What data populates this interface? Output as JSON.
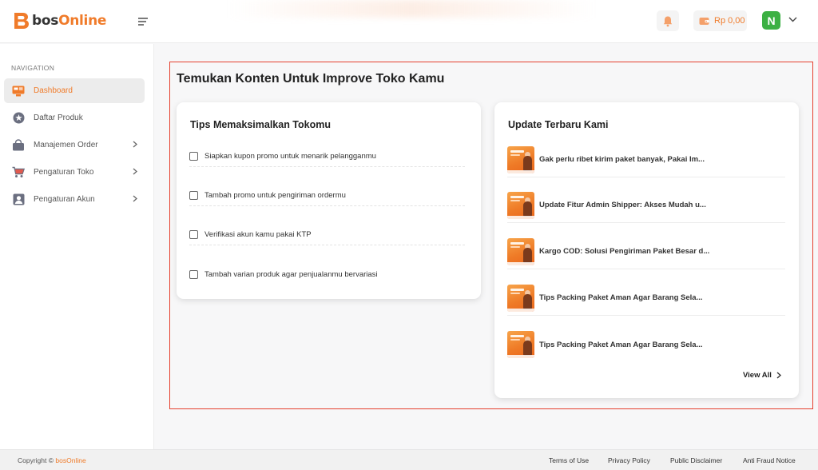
{
  "header": {
    "brand": "bosOnline",
    "brand_prefix": "bos",
    "brand_suffix": "Online",
    "wallet_amount": "Rp 0,00",
    "avatar_initial": "N"
  },
  "sidebar": {
    "nav_title": "NAVIGATION",
    "items": [
      {
        "label": "Dashboard",
        "icon": "dashboard-icon",
        "active": true,
        "has_submenu": false
      },
      {
        "label": "Daftar Produk",
        "icon": "star-icon",
        "active": false,
        "has_submenu": false
      },
      {
        "label": "Manajemen Order",
        "icon": "bag-icon",
        "active": false,
        "has_submenu": true
      },
      {
        "label": "Pengaturan Toko",
        "icon": "cart-icon",
        "active": false,
        "has_submenu": true
      },
      {
        "label": "Pengaturan Akun",
        "icon": "user-icon",
        "active": false,
        "has_submenu": true
      }
    ]
  },
  "main": {
    "title": "Temukan Konten Untuk Improve Toko Kamu",
    "tips": {
      "title": "Tips Memaksimalkan Tokomu",
      "items": [
        "Siapkan kupon promo untuk menarik pelangganmu",
        "Tambah promo untuk pengiriman ordermu",
        "Verifikasi akun kamu pakai KTP",
        "Tambah varian produk agar penjualanmu bervariasi"
      ]
    },
    "updates": {
      "title": "Update Terbaru Kami",
      "items": [
        "Gak perlu ribet kirim paket banyak, Pakai Im...",
        "Update Fitur Admin Shipper: Akses Mudah u...",
        "Kargo COD: Solusi Pengiriman Paket Besar d...",
        "Tips Packing Paket Aman Agar Barang Sela...",
        "Tips Packing Paket Aman Agar Barang Sela..."
      ],
      "view_all": "View All"
    }
  },
  "footer": {
    "copyright_prefix": "Copyright ©",
    "copyright_brand": "bosOnline",
    "links": [
      "Terms of Use",
      "Privacy Policy",
      "Public Disclaimer",
      "Anti Fraud Notice"
    ]
  },
  "colors": {
    "accent": "#f07b2a",
    "highlight_border": "#e5402e",
    "avatar": "#3cb043"
  }
}
